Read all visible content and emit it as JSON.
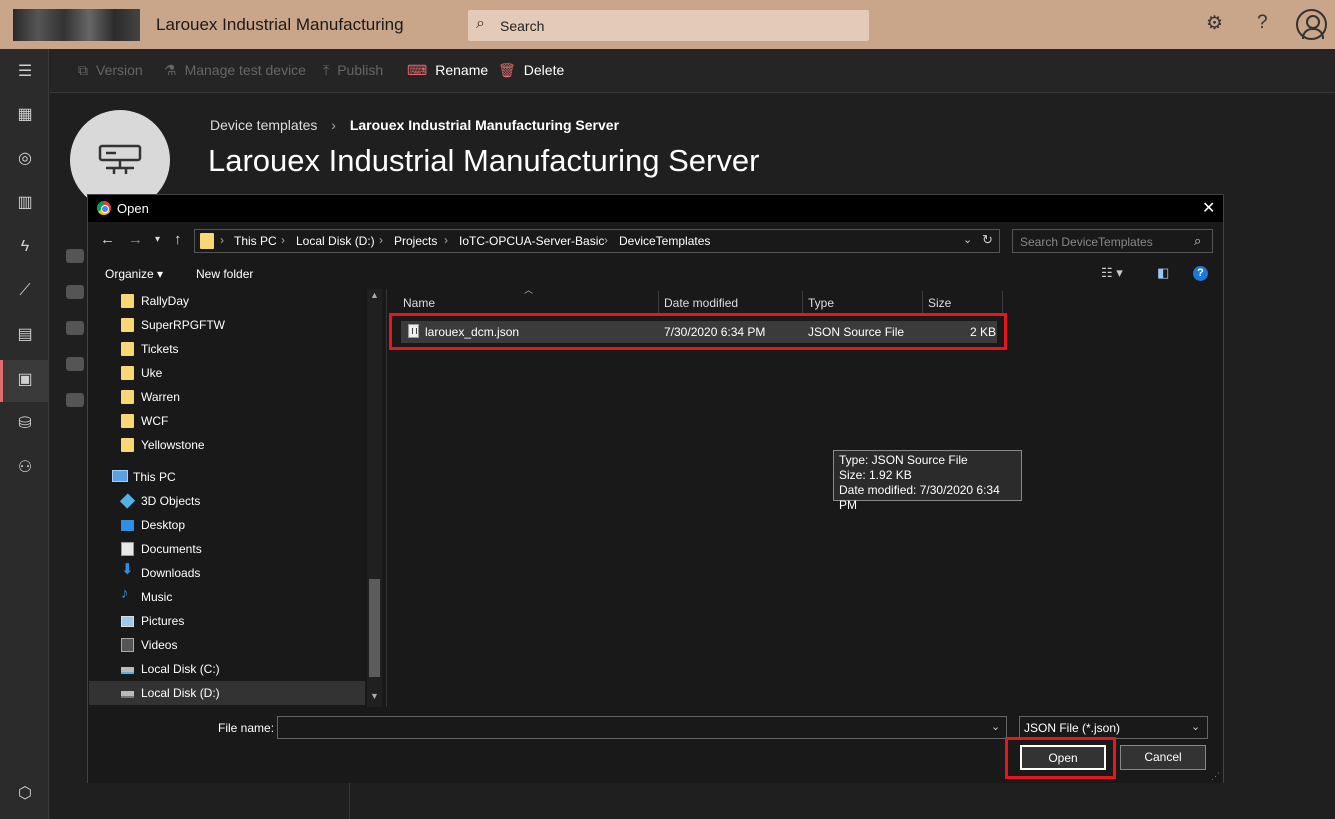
{
  "app": {
    "name": "Larouex Industrial Manufacturing",
    "search_placeholder": "Search",
    "settings_icon": "gear-icon",
    "help_icon": "help-icon",
    "account_icon": "avatar-icon"
  },
  "toolbar": {
    "version": "Version",
    "manage_test_device": "Manage test device",
    "publish": "Publish",
    "rename": "Rename",
    "delete": "Delete"
  },
  "page": {
    "breadcrumb_root": "Device templates",
    "breadcrumb_current": "Larouex Industrial Manufacturing Server",
    "title": "Larouex Industrial Manufacturing Server"
  },
  "dialog": {
    "title": "Open",
    "close": "✕",
    "path": [
      "This PC",
      "Local Disk (D:)",
      "Projects",
      "IoTC-OPCUA-Server-Basic",
      "DeviceTemplates"
    ],
    "search_placeholder": "Search DeviceTemplates",
    "organize": "Organize ▾",
    "new_folder": "New folder",
    "nav_items": [
      {
        "label": "RallyDay",
        "icon": "folder-icon"
      },
      {
        "label": "SuperRPGFTW",
        "icon": "folder-icon"
      },
      {
        "label": "Tickets",
        "icon": "folder-icon"
      },
      {
        "label": "Uke",
        "icon": "folder-icon"
      },
      {
        "label": "Warren",
        "icon": "folder-icon"
      },
      {
        "label": "WCF",
        "icon": "folder-icon"
      },
      {
        "label": "Yellowstone",
        "icon": "folder-icon"
      },
      {
        "label": "This PC",
        "icon": "computer-icon"
      },
      {
        "label": "3D Objects",
        "icon": "cube-icon"
      },
      {
        "label": "Desktop",
        "icon": "desktop-icon"
      },
      {
        "label": "Documents",
        "icon": "documents-icon"
      },
      {
        "label": "Downloads",
        "icon": "download-icon"
      },
      {
        "label": "Music",
        "icon": "music-icon"
      },
      {
        "label": "Pictures",
        "icon": "pictures-icon"
      },
      {
        "label": "Videos",
        "icon": "videos-icon"
      },
      {
        "label": "Local Disk (C:)",
        "icon": "drive-icon"
      },
      {
        "label": "Local Disk (D:)",
        "icon": "drive-icon"
      }
    ],
    "columns": {
      "name": "Name",
      "date": "Date modified",
      "type": "Type",
      "size": "Size"
    },
    "file": {
      "name": "larouex_dcm.json",
      "date": "7/30/2020 6:34 PM",
      "type": "JSON Source File",
      "size": "2 KB"
    },
    "tooltip": {
      "type": "Type: JSON Source File",
      "size": "Size: 1.92 KB",
      "date": "Date modified: 7/30/2020 6:34 PM"
    },
    "file_name_label": "File name:",
    "file_name_value": "",
    "file_type": "JSON File (*.json)",
    "open_button": "Open",
    "cancel_button": "Cancel"
  }
}
